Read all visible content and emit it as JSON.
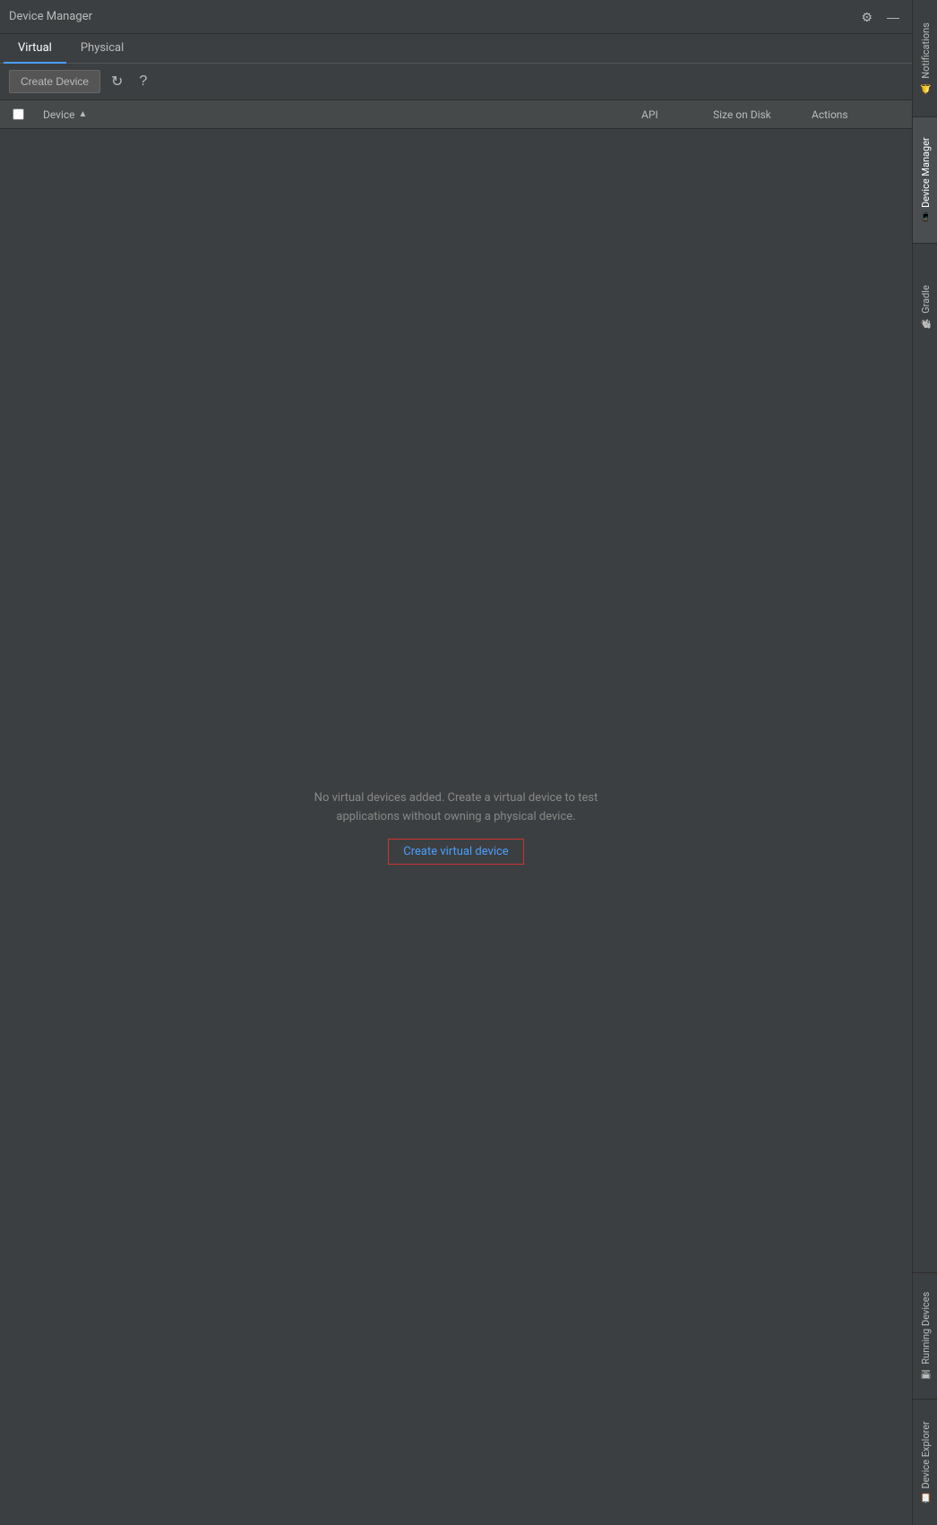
{
  "titleBar": {
    "title": "Device Manager",
    "settingsIcon": "⚙",
    "minimizeIcon": "—"
  },
  "tabs": [
    {
      "id": "virtual",
      "label": "Virtual",
      "active": true
    },
    {
      "id": "physical",
      "label": "Physical",
      "active": false
    }
  ],
  "toolbar": {
    "createDeviceLabel": "Create Device",
    "refreshIcon": "↻",
    "helpIcon": "?"
  },
  "tableHeader": {
    "deviceLabel": "Device",
    "apiLabel": "API",
    "sizeOnDiskLabel": "Size on Disk",
    "actionsLabel": "Actions"
  },
  "emptyState": {
    "message": "No virtual devices added. Create a virtual device to test\napplications without owning a physical device.",
    "linkLabel": "Create virtual device"
  },
  "rightSidebar": {
    "items": [
      {
        "id": "notifications",
        "label": "Notifications",
        "icon": "🔔"
      },
      {
        "id": "device-manager",
        "label": "Device Manager",
        "icon": "📱"
      },
      {
        "id": "gradle",
        "label": "Gradle",
        "icon": "🐘"
      },
      {
        "id": "running-devices",
        "label": "Running Devices",
        "icon": "🖥"
      },
      {
        "id": "device-explorer",
        "label": "Device Explorer",
        "icon": "📋"
      }
    ]
  }
}
